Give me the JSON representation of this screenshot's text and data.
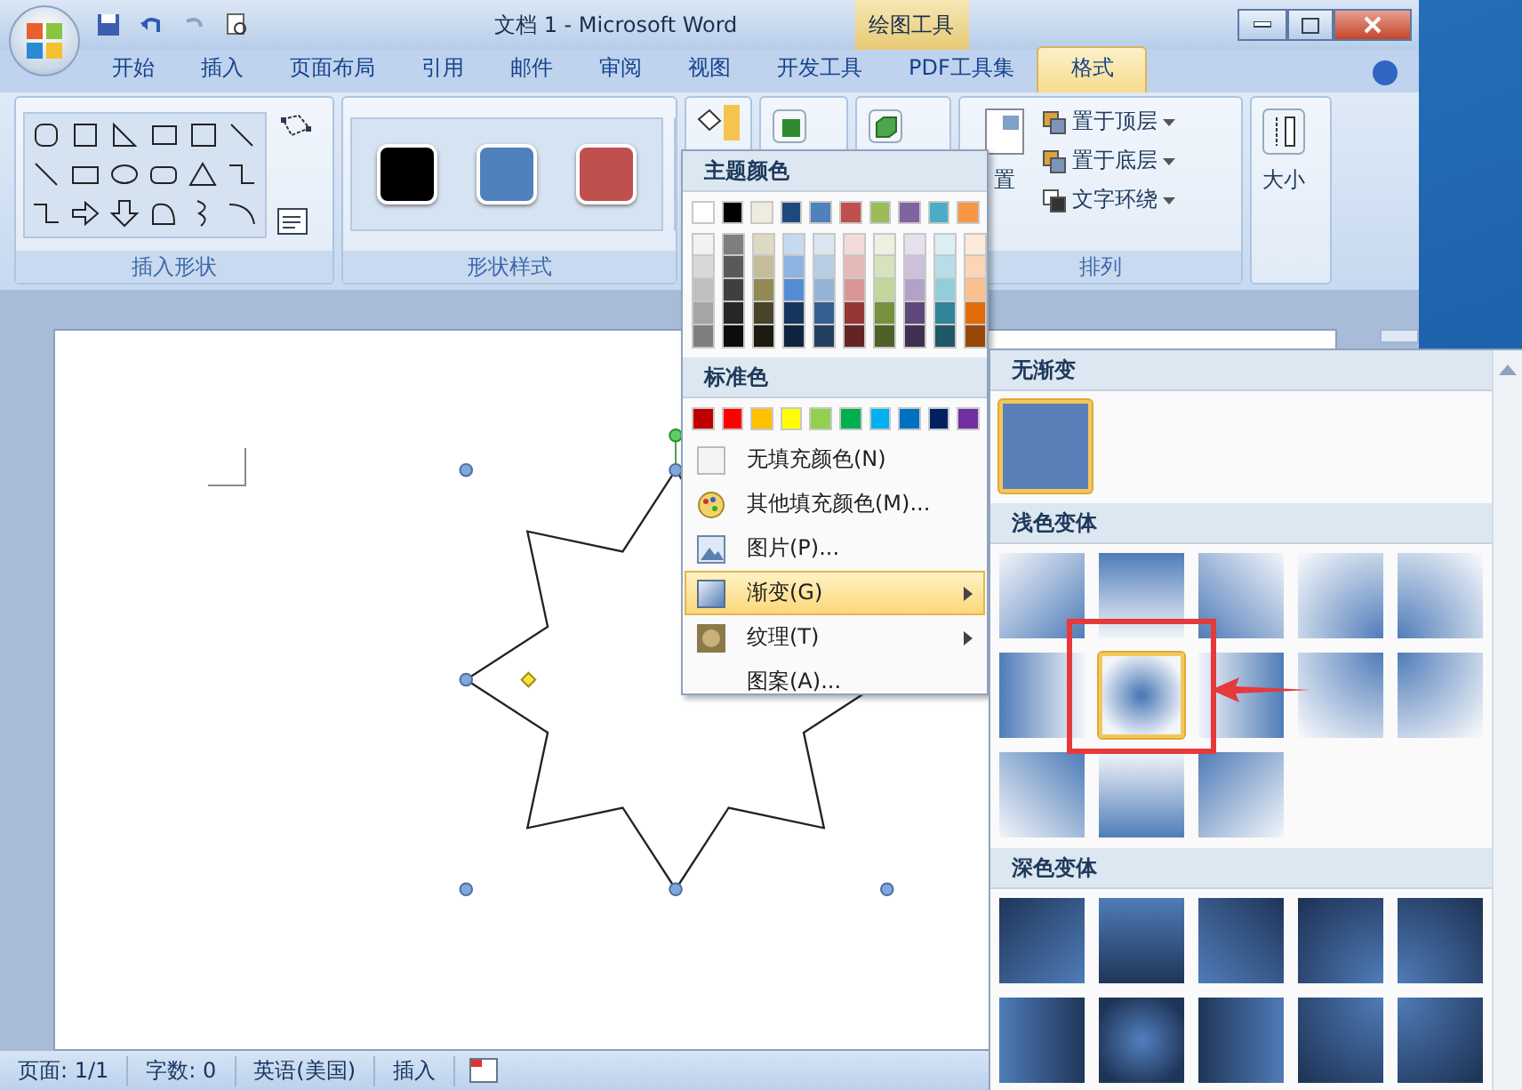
{
  "title_bar": {
    "title": "文档 1 - Microsoft Word",
    "context_tab": "绘图工具"
  },
  "tabs": [
    {
      "label": "开始",
      "selected": false
    },
    {
      "label": "插入",
      "selected": false
    },
    {
      "label": "页面布局",
      "selected": false
    },
    {
      "label": "引用",
      "selected": false
    },
    {
      "label": "邮件",
      "selected": false
    },
    {
      "label": "审阅",
      "selected": false
    },
    {
      "label": "视图",
      "selected": false
    },
    {
      "label": "开发工具",
      "selected": false
    },
    {
      "label": "PDF工具集",
      "selected": false
    },
    {
      "label": "格式",
      "selected": true
    }
  ],
  "ribbon": {
    "shapes_label": "插入形状",
    "styles_label": "形状样式",
    "style_swatches": [
      {
        "color": "#000000"
      },
      {
        "color": "#4f81bd"
      },
      {
        "color": "#c0504d"
      }
    ],
    "arrange_label": "排列",
    "position_label": "置",
    "arrange_items": [
      {
        "label": "置于顶层"
      },
      {
        "label": "置于底层"
      },
      {
        "label": "文字环绕"
      }
    ],
    "size_label": "大小"
  },
  "fill_menu": {
    "theme_heading": "主题颜色",
    "theme_colors": [
      {
        "color": "#ffffff"
      },
      {
        "color": "#000000"
      },
      {
        "color": "#eeece1"
      },
      {
        "color": "#1f497d"
      },
      {
        "color": "#4f81bd"
      },
      {
        "color": "#c0504d"
      },
      {
        "color": "#9bbb59"
      },
      {
        "color": "#8064a2"
      },
      {
        "color": "#4bacc6"
      },
      {
        "color": "#f79646"
      }
    ],
    "shade_rows": [
      [
        {
          "color": "#f2f2f2"
        },
        {
          "color": "#7f7f7f"
        },
        {
          "color": "#ddd9c3"
        },
        {
          "color": "#c6d9f0"
        },
        {
          "color": "#dbe5f1"
        },
        {
          "color": "#f2dcdb"
        },
        {
          "color": "#ebf1dd"
        },
        {
          "color": "#e5e0ec"
        },
        {
          "color": "#dbeef3"
        },
        {
          "color": "#fdeada"
        }
      ],
      [
        {
          "color": "#d8d8d8"
        },
        {
          "color": "#595959"
        },
        {
          "color": "#c4bd97"
        },
        {
          "color": "#8db3e2"
        },
        {
          "color": "#b8cce4"
        },
        {
          "color": "#e5b9b7"
        },
        {
          "color": "#d7e3bc"
        },
        {
          "color": "#ccc1d9"
        },
        {
          "color": "#b7dde8"
        },
        {
          "color": "#fbd5b5"
        }
      ],
      [
        {
          "color": "#bfbfbf"
        },
        {
          "color": "#3f3f3f"
        },
        {
          "color": "#938953"
        },
        {
          "color": "#548dd4"
        },
        {
          "color": "#95b3d7"
        },
        {
          "color": "#d99694"
        },
        {
          "color": "#c3d69b"
        },
        {
          "color": "#b2a2c7"
        },
        {
          "color": "#92cddc"
        },
        {
          "color": "#fac08f"
        }
      ],
      [
        {
          "color": "#a5a5a5"
        },
        {
          "color": "#262626"
        },
        {
          "color": "#494429"
        },
        {
          "color": "#17365d"
        },
        {
          "color": "#366092"
        },
        {
          "color": "#953734"
        },
        {
          "color": "#76923c"
        },
        {
          "color": "#5f497a"
        },
        {
          "color": "#31859b"
        },
        {
          "color": "#e36c09"
        }
      ],
      [
        {
          "color": "#7f7f7f"
        },
        {
          "color": "#0c0c0c"
        },
        {
          "color": "#1d1b10"
        },
        {
          "color": "#0f243e"
        },
        {
          "color": "#244061"
        },
        {
          "color": "#632423"
        },
        {
          "color": "#4f6128"
        },
        {
          "color": "#3f3151"
        },
        {
          "color": "#205867"
        },
        {
          "color": "#974806"
        }
      ]
    ],
    "standard_heading": "标准色",
    "standard_colors": [
      {
        "color": "#c00000"
      },
      {
        "color": "#ff0000"
      },
      {
        "color": "#ffc000"
      },
      {
        "color": "#ffff00"
      },
      {
        "color": "#92d050"
      },
      {
        "color": "#00b050"
      },
      {
        "color": "#00b0f0"
      },
      {
        "color": "#0070c0"
      },
      {
        "color": "#002060"
      },
      {
        "color": "#7030a0"
      }
    ],
    "items": [
      {
        "label": "无填充颜色(N)",
        "kind": "none",
        "submenu": false,
        "selected": false
      },
      {
        "label": "其他填充颜色(M)...",
        "kind": "palette",
        "submenu": false,
        "selected": false
      },
      {
        "label": "图片(P)...",
        "kind": "picture",
        "submenu": false,
        "selected": false
      },
      {
        "label": "渐变(G)",
        "kind": "gradient",
        "submenu": true,
        "selected": true
      },
      {
        "label": "纹理(T)",
        "kind": "texture",
        "submenu": true,
        "selected": false
      },
      {
        "label": "图案(A)...",
        "kind": "pattern",
        "submenu": false,
        "selected": false
      }
    ]
  },
  "gradient_panel": {
    "sections": [
      {
        "heading": "无渐变",
        "kind": "solid",
        "tiles": [
          {
            "kind": "solid",
            "selected": true
          }
        ]
      },
      {
        "heading": "浅色变体",
        "kind": "light",
        "tiles": [
          {
            "kind": "diag-tl",
            "selected": false
          },
          {
            "kind": "top",
            "selected": false
          },
          {
            "kind": "diag-tr",
            "selected": false
          },
          {
            "kind": "corner-br",
            "selected": false
          },
          {
            "kind": "corner-bl",
            "selected": false
          },
          {
            "kind": "left",
            "selected": false
          },
          {
            "kind": "center",
            "selected": true
          },
          {
            "kind": "right",
            "selected": false
          },
          {
            "kind": "corner-tr",
            "selected": false
          },
          {
            "kind": "corner-tl",
            "selected": false
          },
          {
            "kind": "diag-bl",
            "selected": false
          },
          {
            "kind": "bottom",
            "selected": false
          },
          {
            "kind": "diag-br",
            "selected": false
          }
        ]
      },
      {
        "heading": "深色变体",
        "kind": "dark",
        "tiles": [
          {
            "kind": "diag-tl",
            "selected": false
          },
          {
            "kind": "top",
            "selected": false
          },
          {
            "kind": "diag-tr",
            "selected": false
          },
          {
            "kind": "corner-br",
            "selected": false
          },
          {
            "kind": "corner-bl",
            "selected": false
          },
          {
            "kind": "left",
            "selected": false
          },
          {
            "kind": "center",
            "selected": false
          },
          {
            "kind": "right",
            "selected": false
          },
          {
            "kind": "corner-tr",
            "selected": false
          },
          {
            "kind": "corner-tl",
            "selected": false
          }
        ]
      }
    ]
  },
  "status_bar": [
    {
      "label": "页面: 1/1"
    },
    {
      "label": "字数: 0"
    },
    {
      "label": "英语(美国)"
    },
    {
      "label": "插入"
    }
  ]
}
